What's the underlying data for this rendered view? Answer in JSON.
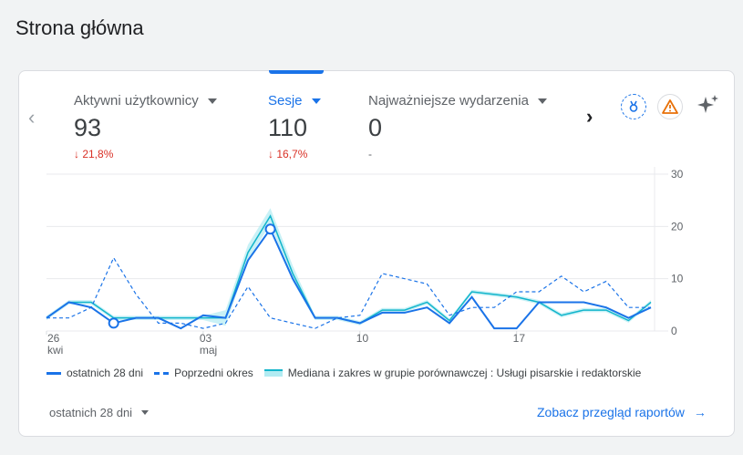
{
  "page_title": "Strona główna",
  "metrics": [
    {
      "label": "Aktywni użytkownicy",
      "value": "93",
      "change": "↓ 21,8%",
      "active": false
    },
    {
      "label": "Sesje",
      "value": "110",
      "change": "↓ 16,7%",
      "active": true
    },
    {
      "label": "Najważniejsze wydarzenia",
      "value": "0",
      "change": "-",
      "active": false
    }
  ],
  "icons": {
    "prev": "chevron-left-icon",
    "next": "chevron-right-icon",
    "medal": "medal-icon",
    "warning": "warning-icon",
    "sparkle": "sparkle-icon"
  },
  "colors": {
    "accent": "#1a73e8",
    "benchmark": "#12b5cb",
    "benchmark_band": "#b2ebf2",
    "decrease": "#d93025"
  },
  "chart_data": {
    "type": "line",
    "x_tick_labels": [
      {
        "day": 0,
        "label": "26",
        "sub": "kwi"
      },
      {
        "day": 7,
        "label": "03",
        "sub": "maj"
      },
      {
        "day": 14,
        "label": "10",
        "sub": ""
      },
      {
        "day": 21,
        "label": "17",
        "sub": ""
      }
    ],
    "y_ticks": [
      0,
      10,
      20,
      30
    ],
    "ylim": [
      0,
      30
    ],
    "xlim": [
      0,
      28
    ],
    "grid": true,
    "series": [
      {
        "name": "ostatnich 28 dni",
        "style": "solid",
        "values": [
          2.5,
          5.5,
          4.5,
          1.5,
          2.5,
          2.5,
          0.5,
          3,
          2.5,
          13.5,
          19.5,
          10,
          2.5,
          2.5,
          1.5,
          3.5,
          3.5,
          4.5,
          1.5,
          6.5,
          0.5,
          0.5,
          5.5,
          5.5,
          5.5,
          4.5,
          2.5,
          4.5
        ]
      },
      {
        "name": "Poprzedni okres",
        "style": "dashed",
        "values": [
          2.5,
          2.5,
          4.5,
          14,
          7,
          1.5,
          1.5,
          0.5,
          1.5,
          8.5,
          2.5,
          1.5,
          0.5,
          2.5,
          3,
          11,
          10,
          9,
          3,
          4.5,
          4.5,
          7.5,
          7.5,
          10.5,
          7.5,
          9.5,
          4.5,
          4.5
        ]
      },
      {
        "name": "Mediana i zakres w grupie porównawczej : Usługi pisarskie i redaktorskie",
        "style": "band",
        "values": [
          2.5,
          5.5,
          5.5,
          2.5,
          2.5,
          2.5,
          2.5,
          2.5,
          2.5,
          15,
          22,
          11,
          2.5,
          2.5,
          1.5,
          4,
          4,
          5.5,
          2,
          7.5,
          7,
          6.5,
          5.5,
          3,
          4,
          4,
          2,
          5.5
        ]
      }
    ],
    "highlight_points": [
      {
        "series": 0,
        "day": 3
      },
      {
        "series": 0,
        "day": 10
      }
    ]
  },
  "legend": [
    {
      "label": "ostatnich 28 dni"
    },
    {
      "label": "Poprzedni okres"
    },
    {
      "label": "Mediana i zakres w grupie porównawczej : Usługi pisarskie i redaktorskie"
    }
  ],
  "footer": {
    "period_label": "ostatnich 28 dni",
    "report_link": "Zobacz przegląd raportów",
    "report_arrow": "→"
  }
}
